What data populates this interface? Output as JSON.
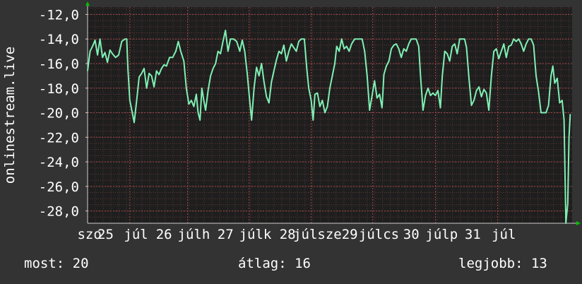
{
  "chart_data": {
    "type": "line",
    "ylabel": "onlinestream.live",
    "ylim": [
      -29.0,
      -11.4
    ],
    "yticks": [
      -12,
      -14,
      -16,
      -18,
      -20,
      -22,
      -24,
      -26,
      -28
    ],
    "ytick_labels": [
      "-12,0",
      "-14,0",
      "-16,0",
      "-18,0",
      "-20,0",
      "-22,0",
      "-24,0",
      "-26,0",
      "-28,0"
    ],
    "xlim": [
      0,
      7.8
    ],
    "xtick_labels": [
      {
        "x": 0.03,
        "label": "szo"
      },
      {
        "x": 0.29,
        "label": "25"
      },
      {
        "x": 0.78,
        "label": "júl"
      },
      {
        "x": 1.23,
        "label": "26"
      },
      {
        "x": 1.71,
        "label": "júlh"
      },
      {
        "x": 2.22,
        "label": "27"
      },
      {
        "x": 2.7,
        "label": "júlk"
      },
      {
        "x": 3.22,
        "label": "28"
      },
      {
        "x": 3.7,
        "label": "júlsze"
      },
      {
        "x": 4.22,
        "label": "29"
      },
      {
        "x": 4.69,
        "label": "júlcs"
      },
      {
        "x": 5.21,
        "label": "30"
      },
      {
        "x": 5.7,
        "label": "júlp"
      },
      {
        "x": 6.2,
        "label": "31"
      },
      {
        "x": 6.7,
        "label": "júl"
      }
    ],
    "grid": true,
    "series": [
      {
        "color": "#7ff0b4",
        "points": [
          [
            0.0,
            -16.6
          ],
          [
            0.04,
            -15.0
          ],
          [
            0.08,
            -14.6
          ],
          [
            0.12,
            -14.1
          ],
          [
            0.16,
            -15.3
          ],
          [
            0.2,
            -14.0
          ],
          [
            0.24,
            -15.5
          ],
          [
            0.28,
            -15.1
          ],
          [
            0.32,
            -15.9
          ],
          [
            0.36,
            -14.9
          ],
          [
            0.4,
            -15.2
          ],
          [
            0.45,
            -15.5
          ],
          [
            0.5,
            -15.3
          ],
          [
            0.55,
            -14.2
          ],
          [
            0.6,
            -14.0
          ],
          [
            0.63,
            -14.0
          ],
          [
            0.65,
            -16.5
          ],
          [
            0.68,
            -19.0
          ],
          [
            0.72,
            -20.0
          ],
          [
            0.75,
            -20.8
          ],
          [
            0.79,
            -19.0
          ],
          [
            0.83,
            -17.1
          ],
          [
            0.87,
            -16.8
          ],
          [
            0.91,
            -16.4
          ],
          [
            0.95,
            -18.0
          ],
          [
            0.99,
            -16.8
          ],
          [
            1.03,
            -17.0
          ],
          [
            1.07,
            -17.9
          ],
          [
            1.11,
            -16.6
          ],
          [
            1.15,
            -16.9
          ],
          [
            1.19,
            -16.4
          ],
          [
            1.23,
            -16.1
          ],
          [
            1.27,
            -16.2
          ],
          [
            1.32,
            -15.5
          ],
          [
            1.37,
            -15.5
          ],
          [
            1.42,
            -15.0
          ],
          [
            1.46,
            -14.2
          ],
          [
            1.5,
            -15.0
          ],
          [
            1.55,
            -15.8
          ],
          [
            1.59,
            -18.0
          ],
          [
            1.63,
            -19.3
          ],
          [
            1.67,
            -19.0
          ],
          [
            1.71,
            -19.5
          ],
          [
            1.75,
            -18.5
          ],
          [
            1.78,
            -20.0
          ],
          [
            1.81,
            -20.6
          ],
          [
            1.84,
            -18.0
          ],
          [
            1.87,
            -19.0
          ],
          [
            1.9,
            -19.8
          ],
          [
            1.94,
            -18.2
          ],
          [
            1.98,
            -17.0
          ],
          [
            2.02,
            -16.4
          ],
          [
            2.06,
            -16.0
          ],
          [
            2.1,
            -15.0
          ],
          [
            2.14,
            -15.2
          ],
          [
            2.18,
            -14.2
          ],
          [
            2.22,
            -13.3
          ],
          [
            2.26,
            -15.0
          ],
          [
            2.3,
            -14.0
          ],
          [
            2.35,
            -14.0
          ],
          [
            2.4,
            -14.2
          ],
          [
            2.45,
            -15.0
          ],
          [
            2.49,
            -14.1
          ],
          [
            2.53,
            -15.0
          ],
          [
            2.57,
            -16.8
          ],
          [
            2.61,
            -19.0
          ],
          [
            2.64,
            -20.6
          ],
          [
            2.68,
            -18.0
          ],
          [
            2.72,
            -16.3
          ],
          [
            2.76,
            -17.0
          ],
          [
            2.8,
            -16.0
          ],
          [
            2.84,
            -17.5
          ],
          [
            2.88,
            -18.7
          ],
          [
            2.92,
            -19.2
          ],
          [
            2.96,
            -17.5
          ],
          [
            3.0,
            -16.6
          ],
          [
            3.04,
            -15.7
          ],
          [
            3.08,
            -15.0
          ],
          [
            3.12,
            -15.2
          ],
          [
            3.16,
            -14.5
          ],
          [
            3.2,
            -15.8
          ],
          [
            3.24,
            -15.0
          ],
          [
            3.28,
            -14.4
          ],
          [
            3.32,
            -14.7
          ],
          [
            3.36,
            -15.0
          ],
          [
            3.4,
            -14.2
          ],
          [
            3.44,
            -14.0
          ],
          [
            3.49,
            -14.0
          ],
          [
            3.53,
            -16.5
          ],
          [
            3.56,
            -18.0
          ],
          [
            3.6,
            -19.0
          ],
          [
            3.63,
            -20.6
          ],
          [
            3.66,
            -18.5
          ],
          [
            3.7,
            -18.4
          ],
          [
            3.74,
            -19.5
          ],
          [
            3.78,
            -19.0
          ],
          [
            3.82,
            -20.0
          ],
          [
            3.86,
            -19.5
          ],
          [
            3.9,
            -18.0
          ],
          [
            3.94,
            -17.0
          ],
          [
            3.98,
            -16.0
          ],
          [
            4.01,
            -14.6
          ],
          [
            4.05,
            -15.0
          ],
          [
            4.09,
            -14.0
          ],
          [
            4.13,
            -14.8
          ],
          [
            4.17,
            -14.6
          ],
          [
            4.21,
            -15.0
          ],
          [
            4.25,
            -14.4
          ],
          [
            4.3,
            -14.0
          ],
          [
            4.36,
            -14.0
          ],
          [
            4.42,
            -14.0
          ],
          [
            4.46,
            -15.0
          ],
          [
            4.5,
            -17.0
          ],
          [
            4.54,
            -19.8
          ],
          [
            4.58,
            -18.6
          ],
          [
            4.62,
            -17.4
          ],
          [
            4.66,
            -18.8
          ],
          [
            4.7,
            -18.5
          ],
          [
            4.74,
            -19.6
          ],
          [
            4.77,
            -16.9
          ],
          [
            4.81,
            -16.2
          ],
          [
            4.85,
            -15.8
          ],
          [
            4.89,
            -14.8
          ],
          [
            4.93,
            -14.5
          ],
          [
            4.97,
            -14.4
          ],
          [
            5.01,
            -14.8
          ],
          [
            5.05,
            -15.5
          ],
          [
            5.09,
            -14.8
          ],
          [
            5.13,
            -15.0
          ],
          [
            5.17,
            -14.4
          ],
          [
            5.21,
            -14.0
          ],
          [
            5.25,
            -14.0
          ],
          [
            5.29,
            -14.0
          ],
          [
            5.33,
            -14.6
          ],
          [
            5.36,
            -17.0
          ],
          [
            5.4,
            -19.8
          ],
          [
            5.44,
            -18.6
          ],
          [
            5.48,
            -18.0
          ],
          [
            5.52,
            -18.6
          ],
          [
            5.56,
            -18.4
          ],
          [
            5.6,
            -18.6
          ],
          [
            5.64,
            -18.2
          ],
          [
            5.68,
            -19.6
          ],
          [
            5.71,
            -17.0
          ],
          [
            5.75,
            -15.0
          ],
          [
            5.79,
            -15.2
          ],
          [
            5.83,
            -15.8
          ],
          [
            5.87,
            -14.6
          ],
          [
            5.91,
            -14.4
          ],
          [
            5.95,
            -15.2
          ],
          [
            5.99,
            -14.0
          ],
          [
            6.03,
            -14.0
          ],
          [
            6.07,
            -14.0
          ],
          [
            6.1,
            -14.7
          ],
          [
            6.14,
            -17.2
          ],
          [
            6.18,
            -19.4
          ],
          [
            6.22,
            -19.0
          ],
          [
            6.26,
            -18.2
          ],
          [
            6.3,
            -17.9
          ],
          [
            6.34,
            -18.7
          ],
          [
            6.38,
            -18.1
          ],
          [
            6.42,
            -18.4
          ],
          [
            6.46,
            -19.8
          ],
          [
            6.5,
            -17.0
          ],
          [
            6.54,
            -15.0
          ],
          [
            6.58,
            -14.8
          ],
          [
            6.62,
            -15.6
          ],
          [
            6.66,
            -15.0
          ],
          [
            6.7,
            -14.4
          ],
          [
            6.74,
            -15.5
          ],
          [
            6.78,
            -14.6
          ],
          [
            6.82,
            -14.5
          ],
          [
            6.86,
            -14.0
          ],
          [
            6.9,
            -14.2
          ],
          [
            6.94,
            -14.0
          ],
          [
            6.98,
            -14.4
          ],
          [
            7.02,
            -15.0
          ],
          [
            7.06,
            -14.4
          ],
          [
            7.1,
            -14.0
          ],
          [
            7.14,
            -14.0
          ],
          [
            7.18,
            -14.5
          ],
          [
            7.22,
            -17.0
          ],
          [
            7.26,
            -18.3
          ],
          [
            7.3,
            -20.0
          ],
          [
            7.34,
            -20.0
          ],
          [
            7.38,
            -20.0
          ],
          [
            7.42,
            -19.4
          ],
          [
            7.46,
            -17.0
          ],
          [
            7.49,
            -16.2
          ],
          [
            7.52,
            -17.6
          ],
          [
            7.56,
            -17.2
          ],
          [
            7.6,
            -19.2
          ],
          [
            7.64,
            -19.0
          ],
          [
            7.67,
            -20.6
          ],
          [
            7.7,
            -29.0
          ],
          [
            7.73,
            -27.4
          ],
          [
            7.75,
            -22.0
          ],
          [
            7.77,
            -20.1
          ]
        ]
      }
    ]
  },
  "footer": {
    "current": "most: 20",
    "average": "átlag: 16",
    "best": "legjobb: 13"
  },
  "colors": {
    "background": "#333333",
    "plot_background": "#1e1e1e",
    "line": "#7ff0b4",
    "grid": "#6a3a3a",
    "axis_arrow": "#00c000",
    "text": "#ffffff"
  }
}
